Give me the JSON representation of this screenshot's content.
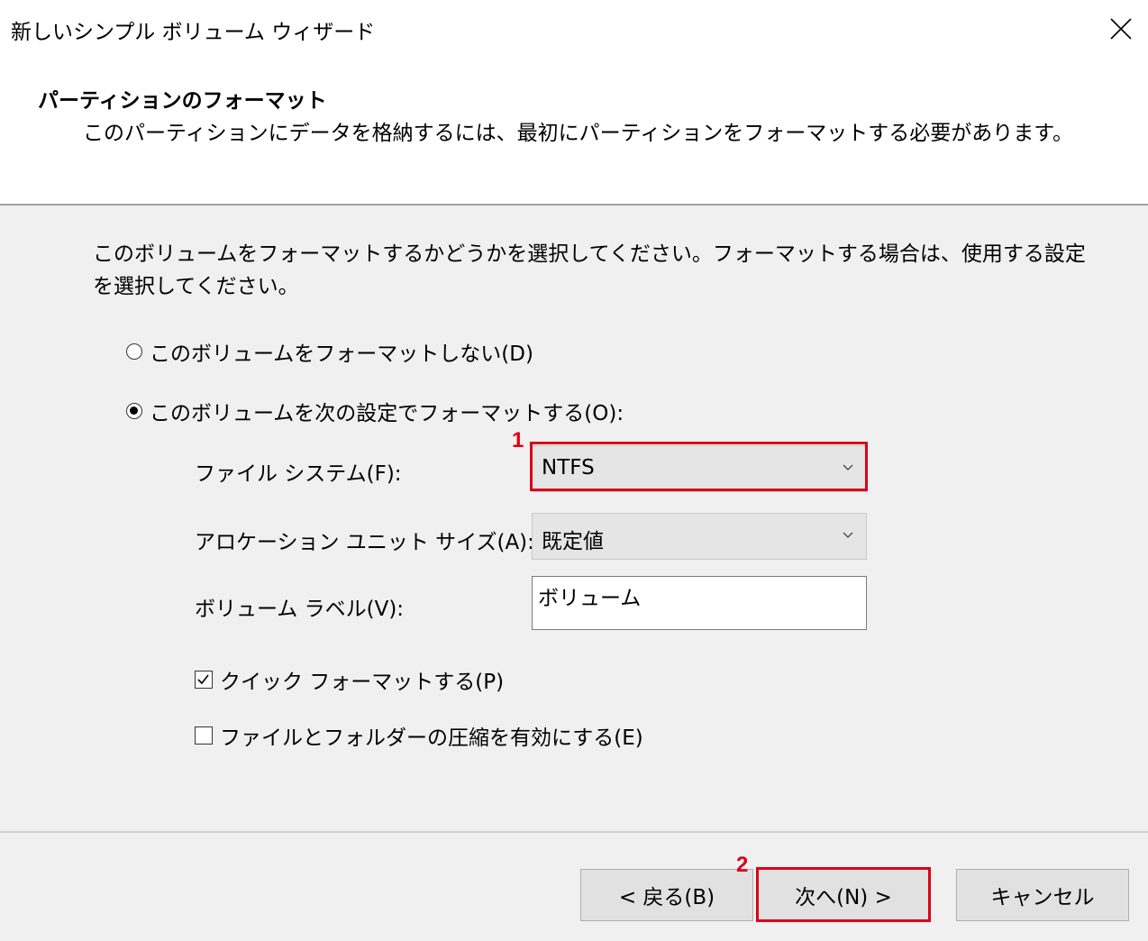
{
  "window": {
    "title": "新しいシンプル ボリューム ウィザード",
    "close_icon": "close-icon"
  },
  "header": {
    "title": "パーティションのフォーマット",
    "description": "このパーティションにデータを格納するには、最初にパーティションをフォーマットする必要があります。"
  },
  "content": {
    "instructions": "このボリュームをフォーマットするかどうかを選択してください。フォーマットする場合は、使用する設定を選択してください。",
    "radio_no_format": {
      "label": "このボリュームをフォーマットしない(D)",
      "checked": false
    },
    "radio_format": {
      "label": "このボリュームを次の設定でフォーマットする(O):",
      "checked": true
    },
    "file_system": {
      "label": "ファイル システム(F):",
      "value": "NTFS"
    },
    "allocation_unit": {
      "label": "アロケーション ユニット サイズ(A):",
      "value": "既定値"
    },
    "volume_label": {
      "label": "ボリューム ラベル(V):",
      "value": "ボリューム"
    },
    "quick_format": {
      "label": "クイック フォーマットする(P)",
      "checked": true
    },
    "compression": {
      "label": "ファイルとフォルダーの圧縮を有効にする(E)",
      "checked": false
    }
  },
  "footer": {
    "back_label": "< 戻る(B)",
    "next_label": "次へ(N) >",
    "cancel_label": "キャンセル"
  },
  "annotations": {
    "marker_1": "1",
    "marker_2": "2",
    "highlight_color": "#d9001b"
  }
}
